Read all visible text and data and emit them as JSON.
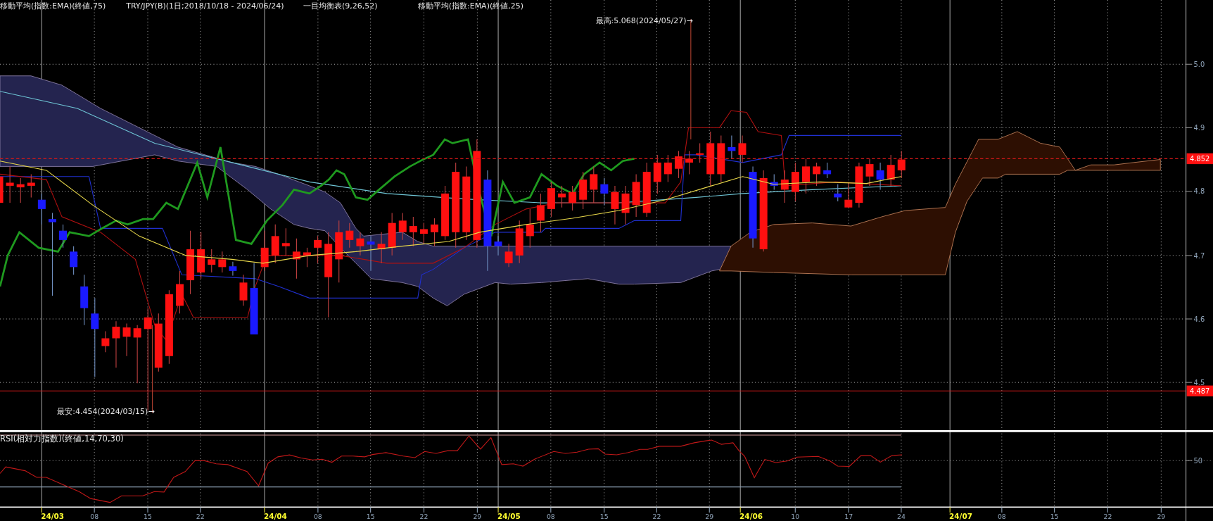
{
  "header": [
    "移動平均(指数:EMA)(終値,75)",
    "TRY/JPY(B)(1日;2018/10/18 - 2024/06/24)",
    "一目均衡表(9,26,52)",
    "移動平均(指数:EMA)(終値,25)"
  ],
  "price_axis": [
    "5.0",
    "4.9",
    "4.8",
    "4.7",
    "4.6",
    "4.5"
  ],
  "price_markers": [
    {
      "label": "4.852",
      "kind": "dashed"
    },
    {
      "label": "4.487",
      "kind": "solid"
    }
  ],
  "annotations": [
    {
      "label": "最高:5.068(2024/05/27)→",
      "kind": "high"
    },
    {
      "label": "最安:4.454(2024/03/15)→",
      "kind": "low"
    }
  ],
  "rsi": {
    "title": "RSI(相対力指数)(終値,14,70,30)",
    "axis": [
      "50"
    ]
  },
  "dates": [
    {
      "label": "24/03",
      "kind": "month"
    },
    {
      "label": "08",
      "kind": "day"
    },
    {
      "label": "15",
      "kind": "day"
    },
    {
      "label": "22",
      "kind": "day"
    },
    {
      "label": "24/04",
      "kind": "month"
    },
    {
      "label": "08",
      "kind": "day"
    },
    {
      "label": "15",
      "kind": "day"
    },
    {
      "label": "22",
      "kind": "day"
    },
    {
      "label": "29",
      "kind": "day"
    },
    {
      "label": "24/05",
      "kind": "month"
    },
    {
      "label": "08",
      "kind": "day"
    },
    {
      "label": "15",
      "kind": "day"
    },
    {
      "label": "22",
      "kind": "day"
    },
    {
      "label": "29",
      "kind": "day"
    },
    {
      "label": "24/06",
      "kind": "month"
    },
    {
      "label": "10",
      "kind": "day"
    },
    {
      "label": "17",
      "kind": "day"
    },
    {
      "label": "24",
      "kind": "day"
    },
    {
      "label": "24/07",
      "kind": "month"
    },
    {
      "label": "08",
      "kind": "day"
    },
    {
      "label": "15",
      "kind": "day"
    },
    {
      "label": "22",
      "kind": "day"
    },
    {
      "label": "29",
      "kind": "day"
    }
  ]
}
